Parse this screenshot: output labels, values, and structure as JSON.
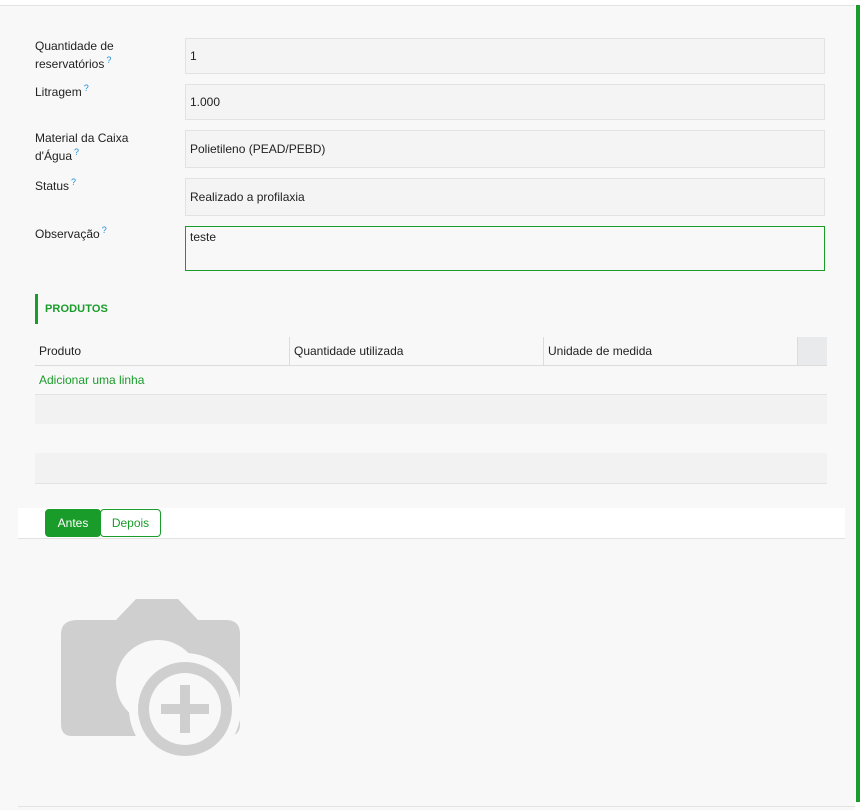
{
  "form": {
    "fields": [
      {
        "label": "Quantidade de reservatórios",
        "help": "?",
        "value": "1"
      },
      {
        "label": "Litragem",
        "help": "?",
        "value": "1.000"
      },
      {
        "label": "Material da Caixa d'Água",
        "help": "?",
        "value": "Polietileno (PEAD/PEBD)"
      },
      {
        "label": "Status",
        "help": "?",
        "value": "Realizado a profilaxia"
      },
      {
        "label": "Observação",
        "help": "?",
        "value": "teste"
      }
    ]
  },
  "produtos": {
    "title": "PRODUTOS",
    "columns": [
      "Produto",
      "Quantidade utilizada",
      "Unidade de medida"
    ],
    "add_line": "Adicionar uma linha"
  },
  "photo_tabs": {
    "tabs": [
      "Antes",
      "Depois"
    ],
    "active": "Antes"
  },
  "colors": {
    "accent": "#1a9c2b",
    "help": "#1a8fd9",
    "placeholder": "#cfcfcf"
  },
  "icons": {
    "photo_placeholder": "camera-plus-icon"
  }
}
